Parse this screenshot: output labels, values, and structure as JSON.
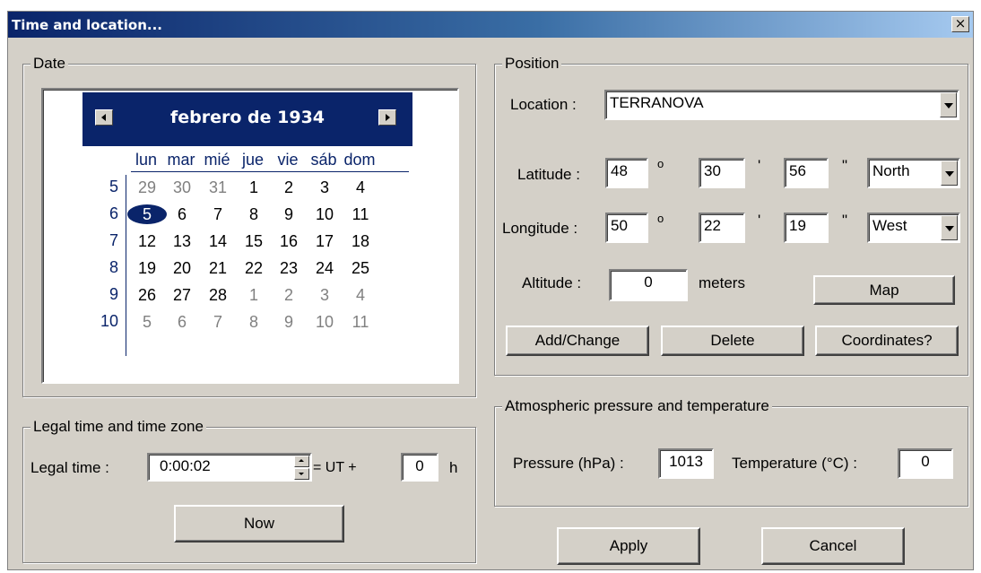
{
  "window": {
    "title": "Time and location...",
    "close_label": "×"
  },
  "date_group": {
    "legend": "Date",
    "calendar": {
      "month_title": "febrero de 1934",
      "day_names": [
        "lun",
        "mar",
        "mié",
        "jue",
        "vie",
        "sáb",
        "dom"
      ],
      "weeks": [
        {
          "num": "5",
          "days": [
            [
              "29",
              true
            ],
            [
              "30",
              true
            ],
            [
              "31",
              true
            ],
            [
              "1",
              false
            ],
            [
              "2",
              false
            ],
            [
              "3",
              false
            ],
            [
              "4",
              false
            ]
          ]
        },
        {
          "num": "6",
          "days": [
            [
              "5",
              false
            ],
            [
              "6",
              false
            ],
            [
              "7",
              false
            ],
            [
              "8",
              false
            ],
            [
              "9",
              false
            ],
            [
              "10",
              false
            ],
            [
              "11",
              false
            ]
          ]
        },
        {
          "num": "7",
          "days": [
            [
              "12",
              false
            ],
            [
              "13",
              false
            ],
            [
              "14",
              false
            ],
            [
              "15",
              false
            ],
            [
              "16",
              false
            ],
            [
              "17",
              false
            ],
            [
              "18",
              false
            ]
          ]
        },
        {
          "num": "8",
          "days": [
            [
              "19",
              false
            ],
            [
              "20",
              false
            ],
            [
              "21",
              false
            ],
            [
              "22",
              false
            ],
            [
              "23",
              false
            ],
            [
              "24",
              false
            ],
            [
              "25",
              false
            ]
          ]
        },
        {
          "num": "9",
          "days": [
            [
              "26",
              false
            ],
            [
              "27",
              false
            ],
            [
              "28",
              false
            ],
            [
              "1",
              true
            ],
            [
              "2",
              true
            ],
            [
              "3",
              true
            ],
            [
              "4",
              true
            ]
          ]
        },
        {
          "num": "10",
          "days": [
            [
              "5",
              true
            ],
            [
              "6",
              true
            ],
            [
              "7",
              true
            ],
            [
              "8",
              true
            ],
            [
              "9",
              true
            ],
            [
              "10",
              true
            ],
            [
              "11",
              true
            ]
          ]
        }
      ],
      "selected_day": "5"
    }
  },
  "legal_time_group": {
    "legend": "Legal time and time zone",
    "label": "Legal time :",
    "time_value": "0:00:02",
    "ut_label": "= UT +",
    "offset_value": "0",
    "unit": "h",
    "now_button": "Now"
  },
  "position_group": {
    "legend": "Position",
    "location_label": "Location :",
    "location_value": "TERRANOVA",
    "latitude": {
      "label": "Latitude :",
      "deg": "48",
      "min": "30",
      "sec": "56",
      "hemisphere": "North"
    },
    "longitude": {
      "label": "Longitude :",
      "deg": "50",
      "min": "22",
      "sec": "19",
      "hemisphere": "West"
    },
    "deg_symbol": "o",
    "min_symbol": "'",
    "sec_symbol": "\"",
    "altitude_label": "Altitude :",
    "altitude_value": "0",
    "altitude_unit": "meters",
    "map_button": "Map",
    "add_change_button": "Add/Change",
    "delete_button": "Delete",
    "coordinates_button": "Coordinates?"
  },
  "atmosphere_group": {
    "legend": "Atmospheric pressure and temperature",
    "pressure_label": "Pressure (hPa) :",
    "pressure_value": "1013",
    "temperature_label": "Temperature (°C) :",
    "temperature_value": "0"
  },
  "footer": {
    "apply_button": "Apply",
    "cancel_button": "Cancel"
  },
  "colors": {
    "title_start": "#0a246a",
    "title_end": "#a6caf0",
    "calendar_accent": "#0a246a",
    "face": "#d4d0c8"
  }
}
